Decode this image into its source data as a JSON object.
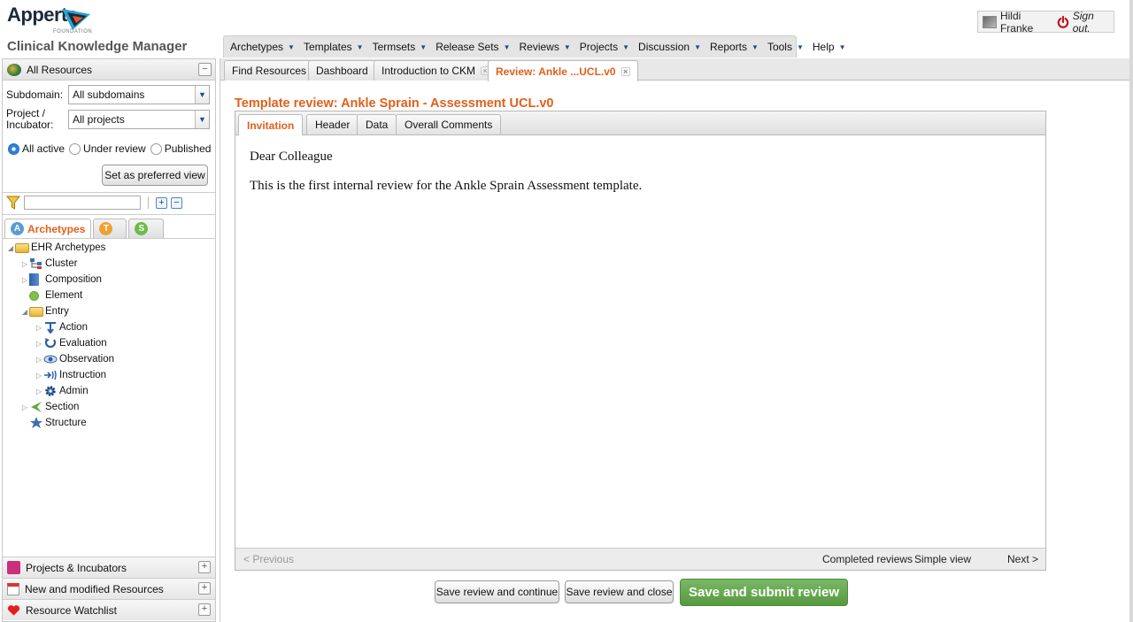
{
  "branding": {
    "logo_text": "Apperta",
    "logo_subtext": "FOUNDATION",
    "app_title": "Clinical Knowledge Manager"
  },
  "user": {
    "name": "Hildi Franke",
    "signout_label": "Sign out."
  },
  "main_menu": [
    {
      "label": "Archetypes"
    },
    {
      "label": "Templates"
    },
    {
      "label": "Termsets"
    },
    {
      "label": "Release Sets"
    },
    {
      "label": "Reviews"
    },
    {
      "label": "Projects"
    },
    {
      "label": "Discussion"
    },
    {
      "label": "Reports"
    },
    {
      "label": "Tools"
    },
    {
      "label": "Help"
    }
  ],
  "sidebar": {
    "title": "All Resources",
    "subdomain_label": "Subdomain:",
    "subdomain_value": "All subdomains",
    "project_label": "Project / Incubator:",
    "project_value": "All projects",
    "status_options": [
      {
        "label": "All active",
        "selected": true
      },
      {
        "label": "Under review",
        "selected": false
      },
      {
        "label": "Published",
        "selected": false
      }
    ],
    "preferred_view_label": "Set as preferred view",
    "search_value": "",
    "resource_tabs": [
      {
        "badge": "A",
        "label": "Archetypes",
        "color": "#5b9bd5"
      },
      {
        "badge": "T",
        "label": "",
        "color": "#f0a030"
      },
      {
        "badge": "S",
        "label": "",
        "color": "#6dbb4a"
      }
    ],
    "tree": {
      "root": "EHR Archetypes",
      "cluster": "Cluster",
      "composition": "Composition",
      "element": "Element",
      "entry": "Entry",
      "action": "Action",
      "evaluation": "Evaluation",
      "observation": "Observation",
      "instruction": "Instruction",
      "admin": "Admin",
      "section": "Section",
      "structure": "Structure"
    },
    "footer": [
      {
        "label": "Projects & Incubators"
      },
      {
        "label": "New and modified Resources"
      },
      {
        "label": "Resource Watchlist"
      }
    ]
  },
  "doc_tabs": [
    {
      "label": "Find Resources"
    },
    {
      "label": "Dashboard"
    },
    {
      "label": "Introduction to CKM"
    },
    {
      "label": "Review: Ankle ...UCL.v0"
    }
  ],
  "review": {
    "title": "Template review: Ankle Sprain - Assessment UCL.v0",
    "tabs": [
      "Invitation",
      "Header",
      "Data",
      "Overall Comments"
    ],
    "greeting": "Dear Colleague",
    "body": "This is the first internal review for the Ankle Sprain Assessment template.",
    "nav": {
      "previous": "< Previous",
      "completed": "Completed reviews",
      "simple": "Simple view",
      "next": "Next >"
    },
    "buttons": {
      "save_continue": "Save review and continue",
      "save_close": "Save review and close",
      "submit": "Save and submit review"
    }
  },
  "colors": {
    "accent_orange": "#e0601a",
    "submit_green": "#57993f",
    "menu_arrow_blue": "#1a4f94"
  }
}
